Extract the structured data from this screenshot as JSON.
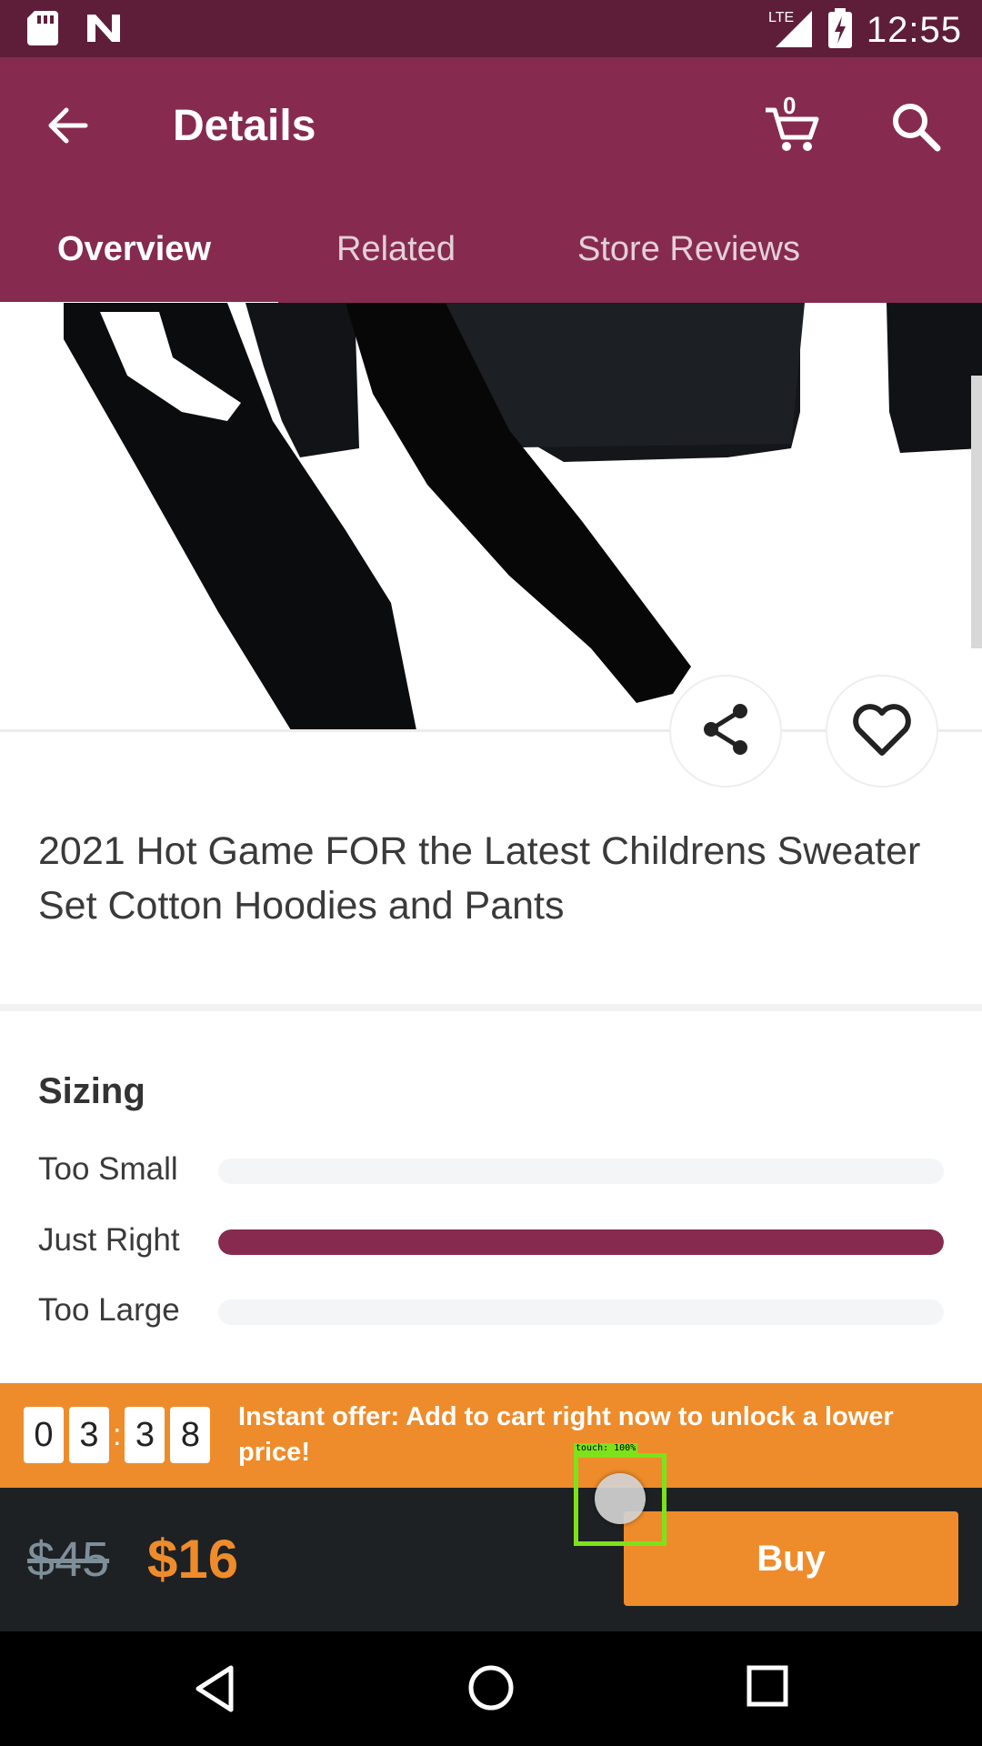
{
  "status_bar": {
    "time": "12:55",
    "network": "LTE"
  },
  "app_bar": {
    "title": "Details",
    "cart_count": "0"
  },
  "tabs": [
    {
      "label": "Overview",
      "active": true
    },
    {
      "label": "Related",
      "active": false
    },
    {
      "label": "Store Reviews",
      "active": false
    }
  ],
  "product": {
    "title": "2021 Hot Game FOR the Latest Childrens Sweater Set Cotton Hoodies and Pants"
  },
  "sizing": {
    "title": "Sizing",
    "rows": [
      {
        "label": "Too Small",
        "fraction": 0.0
      },
      {
        "label": "Just Right",
        "fraction": 1.0
      },
      {
        "label": "Too Large",
        "fraction": 0.0
      }
    ]
  },
  "offer": {
    "digits": [
      "0",
      "3",
      "3",
      "8"
    ],
    "text": "Instant offer: Add to cart right now to unlock a lower price!"
  },
  "pricing": {
    "old_price": "$45",
    "new_price": "$16",
    "buy_label": "Buy"
  },
  "overlay": {
    "touch_label": "touch: 100%"
  },
  "colors": {
    "primary": "#862b4f",
    "status_bar": "#5e1e3a",
    "accent": "#ee8c2b",
    "bottom_bar": "#1d2124"
  }
}
